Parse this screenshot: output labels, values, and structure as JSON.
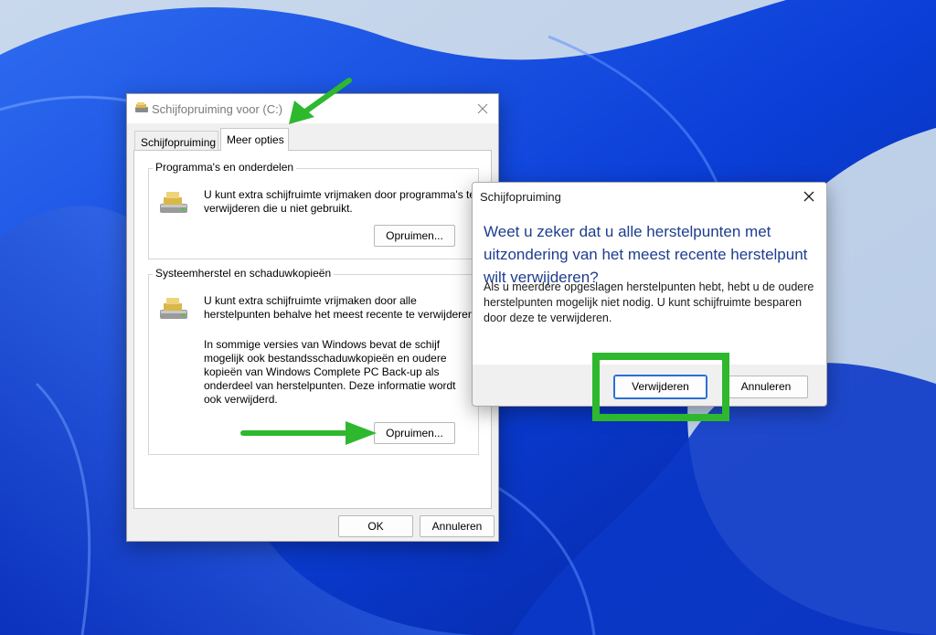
{
  "main_window": {
    "title": "Schijfopruiming voor  (C:)",
    "tabs": [
      {
        "label": "Schijfopruiming",
        "active": false
      },
      {
        "label": "Meer opties",
        "active": true
      }
    ],
    "groups": [
      {
        "title": "Programma's en onderdelen",
        "text": "U kunt extra schijfruimte vrijmaken door programma's te verwijderen die u niet gebruikt.",
        "button": "Opruimen..."
      },
      {
        "title": "Systeemherstel en schaduwkopieën",
        "text": "U kunt extra schijfruimte vrijmaken door alle herstelpunten behalve het meest recente te verwijderen.",
        "note": "In sommige versies van Windows bevat de schijf mogelijk ook bestandsschaduwkopieën en oudere kopieën van Windows Complete PC Back-up als onderdeel van herstelpunten. Deze informatie wordt ook verwijderd.",
        "button": "Opruimen..."
      }
    ],
    "ok_label": "OK",
    "cancel_label": "Annuleren"
  },
  "confirm_dialog": {
    "title": "Schijfopruiming",
    "heading": "Weet u zeker dat u alle herstelpunten met uitzondering van het meest recente herstelpunt wilt verwijderen?",
    "body": "Als u meerdere opgeslagen herstelpunten hebt, hebt u de oudere herstelpunten mogelijk niet nodig. U kunt schijfruimte besparen door deze te verwijderen.",
    "delete_label": "Verwijderen",
    "cancel_label": "Annuleren"
  },
  "icons": {
    "window": "disk-cleanup-icon",
    "drive": "drive-icon",
    "close": "close-icon"
  },
  "colors": {
    "annotation_green": "#2eb82e",
    "heading_blue": "#1e3d8f",
    "focus_blue": "#2a6fd6",
    "wallpaper_blue": "#0a4fe0"
  }
}
